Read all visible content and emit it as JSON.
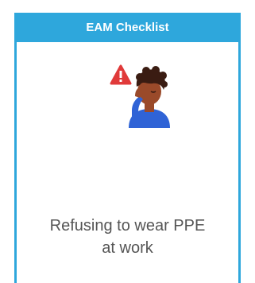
{
  "card": {
    "title": "EAM Checklist",
    "caption_line1": "Refusing to wear PPE",
    "caption_line2": "at work",
    "illustration_icon": "person-refusing-ppe-warning-icon"
  },
  "colors": {
    "accent": "#2ea7dc",
    "warning": "#e03a3a",
    "shirt": "#2f63d6",
    "skin": "#9a4a2a",
    "hair": "#3a1c12",
    "caption_text": "#555555"
  }
}
